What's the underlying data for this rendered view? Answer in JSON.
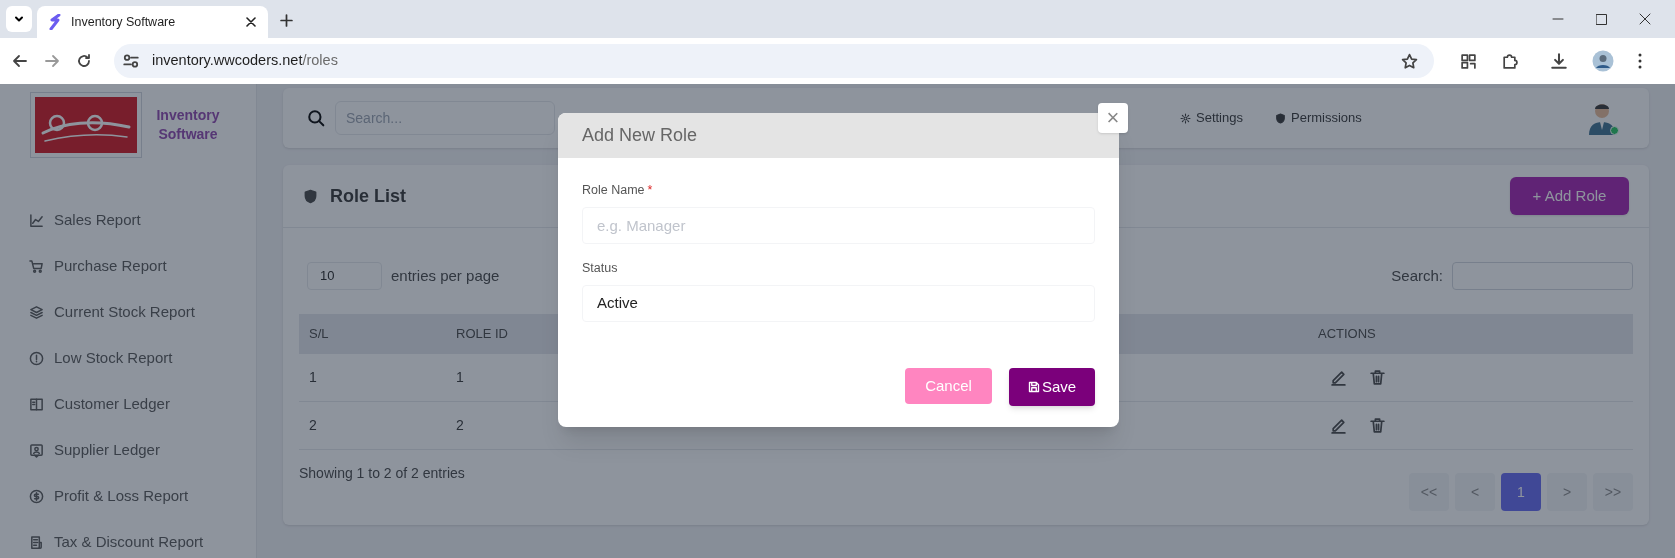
{
  "browser": {
    "tabs": [
      {
        "title": "Inventory Software",
        "selected": true
      }
    ],
    "url_host": "inventory.wwcoders.net",
    "url_path": "/roles"
  },
  "sidebar": {
    "brand": "Inventory Software",
    "items": [
      {
        "label": "Sales Report"
      },
      {
        "label": "Purchase Report"
      },
      {
        "label": "Current Stock Report"
      },
      {
        "label": "Low Stock Report"
      },
      {
        "label": "Customer Ledger"
      },
      {
        "label": "Supplier Ledger"
      },
      {
        "label": "Profit & Loss Report"
      },
      {
        "label": "Tax & Discount Report"
      }
    ]
  },
  "topbar": {
    "search_placeholder": "Search...",
    "nav": [
      {
        "label": "Settings"
      },
      {
        "label": "Permissions"
      }
    ]
  },
  "role_list": {
    "title": "Role List",
    "add_button": "+ Add Role",
    "entries_value": "10",
    "entries_label": "entries per page",
    "search_label": "Search:",
    "table": {
      "columns": [
        {
          "label": "S/L",
          "kind": "text"
        },
        {
          "label": "ROLE ID",
          "kind": "text"
        },
        {
          "label": "ACTIONS",
          "kind": "actions"
        }
      ],
      "rows": [
        {
          "cells": [
            "1",
            "1"
          ]
        },
        {
          "cells": [
            "2",
            "2"
          ]
        }
      ]
    },
    "footer": "Showing 1 to 2 of 2 entries",
    "pagination": [
      {
        "label": "<<",
        "selected": false
      },
      {
        "label": "<",
        "selected": false
      },
      {
        "label": "1",
        "selected": true
      },
      {
        "label": ">",
        "selected": false
      },
      {
        "label": ">>",
        "selected": false
      }
    ]
  },
  "modal": {
    "title": "Add New Role",
    "close": "×",
    "fields": [
      {
        "kind": "text",
        "label": "Role Name",
        "required_mark": "*",
        "placeholder": "e.g. Manager"
      },
      {
        "kind": "select",
        "label": "Status",
        "value": "Active"
      }
    ],
    "buttons": [
      {
        "kind": "cancel",
        "label": "Cancel"
      },
      {
        "kind": "save",
        "label": "Save"
      }
    ]
  }
}
